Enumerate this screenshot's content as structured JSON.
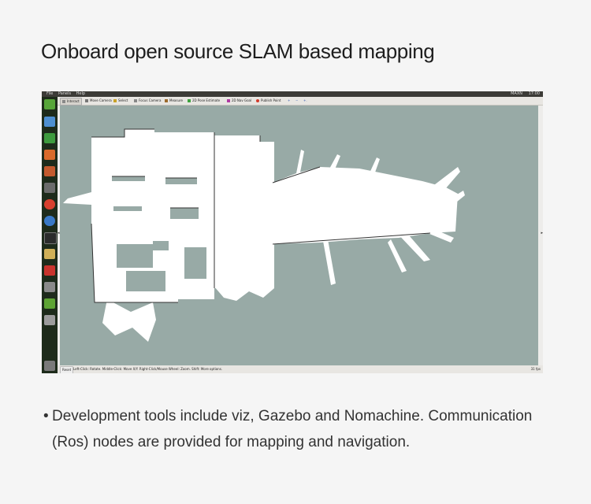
{
  "page": {
    "title": "Onboard open source SLAM based mapping",
    "caption_bullet": "•",
    "caption": "Development tools include viz, Gazebo and Nomachine. Communication (Ros) nodes are provided for mapping and navigation."
  },
  "menubar": {
    "items": [
      "File",
      "Panels",
      "Help"
    ],
    "tray": [
      "MAXN",
      "17:00"
    ]
  },
  "launcher": {
    "icons": [
      "ubuntu-logo-icon",
      "document-icon",
      "spreadsheet-icon",
      "presentation-icon",
      "image-icon",
      "settings-icon",
      "chrome-icon",
      "chromium-icon",
      "terminal-icon",
      "text-editor-icon",
      "rviz-icon",
      "rviz-label-icon",
      "qt-icon",
      "drive-icon",
      "trash-icon"
    ]
  },
  "toolbar": {
    "tools": [
      "Interact",
      "Move Camera",
      "Select",
      "Focus Camera",
      "Measure",
      "2D Pose Estimate",
      "2D Nav Goal",
      "Publish Point"
    ],
    "extras": [
      "+",
      "−",
      "+."
    ]
  },
  "viewport": {
    "background": "#98aaa6",
    "map_color": "#ffffff"
  },
  "statusbar": {
    "reset": "Reset",
    "hint": "Left-Click: Rotate. Middle-Click: Move X/Y. Right-Click/Mouse Wheel: Zoom. Shift: More options.",
    "fps": "31 fps"
  }
}
